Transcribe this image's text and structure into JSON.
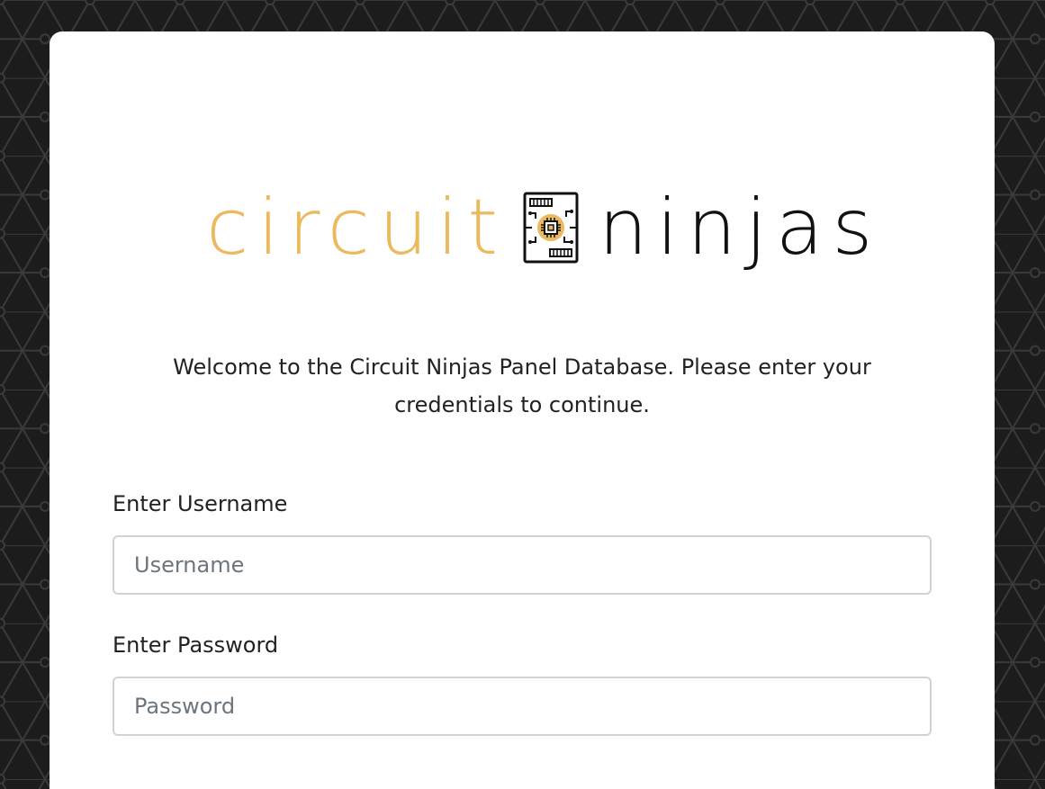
{
  "logo": {
    "word_left": "circuit",
    "word_right": "ninjas",
    "icon": "circuit-chip-icon",
    "accent_color": "#ecba5e",
    "dark_color": "#111111"
  },
  "welcome_text": "Welcome to the Circuit Ninjas Panel Database. Please enter your credentials to continue.",
  "form": {
    "username_label": "Enter Username",
    "username_placeholder": "Username",
    "username_value": "",
    "password_label": "Enter Password",
    "password_placeholder": "Password",
    "password_value": ""
  },
  "colors": {
    "background": "#1c1c1c",
    "card": "#ffffff",
    "input_border": "#cfd2d6",
    "text": "#222222"
  }
}
